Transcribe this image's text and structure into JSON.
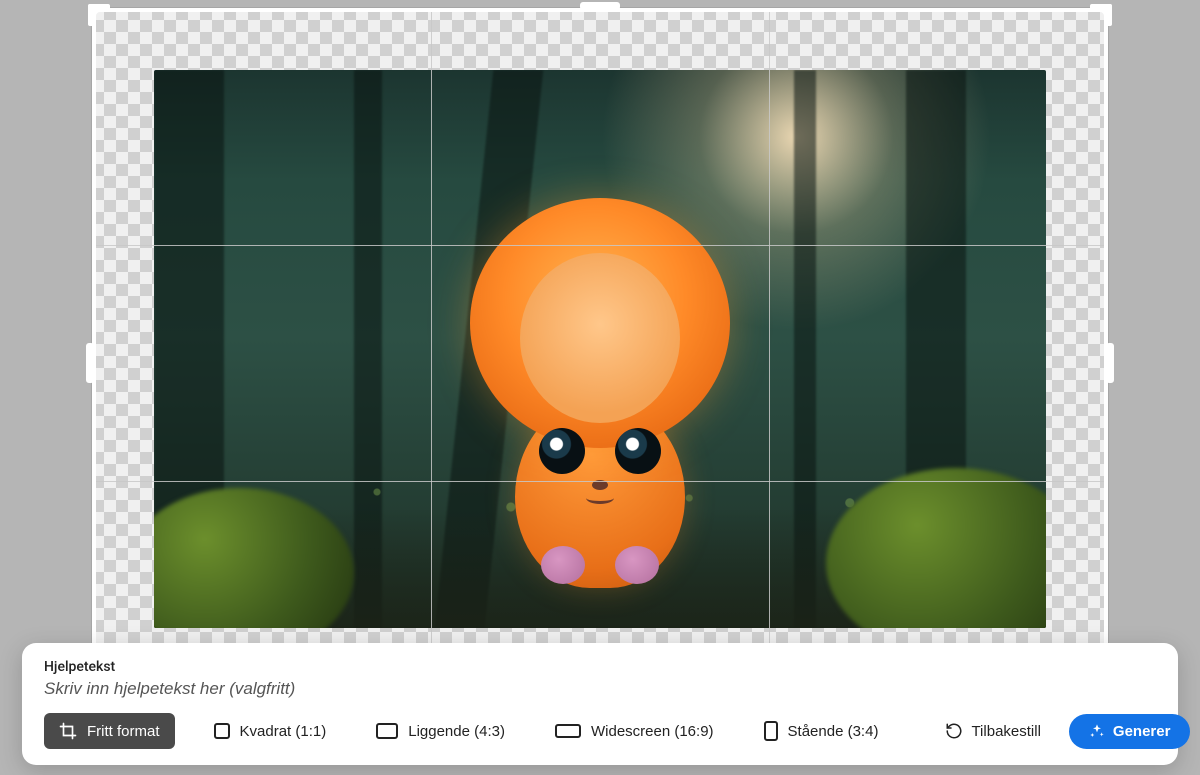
{
  "panel": {
    "label": "Hjelpetekst",
    "placeholder": "Skriv inn hjelpetekst her (valgfritt)",
    "value": ""
  },
  "aspect": {
    "free": "Fritt format",
    "square": "Kvadrat (1:1)",
    "landscape": "Liggende (4:3)",
    "widescreen": "Widescreen (16:9)",
    "portrait": "Stående (3:4)"
  },
  "actions": {
    "reset": "Tilbakestill",
    "generate": "Generer"
  },
  "image": {
    "description": "Cute fluffy orange creature with big eyes standing on forest floor with moss and trees, soft sunlight through mist"
  }
}
